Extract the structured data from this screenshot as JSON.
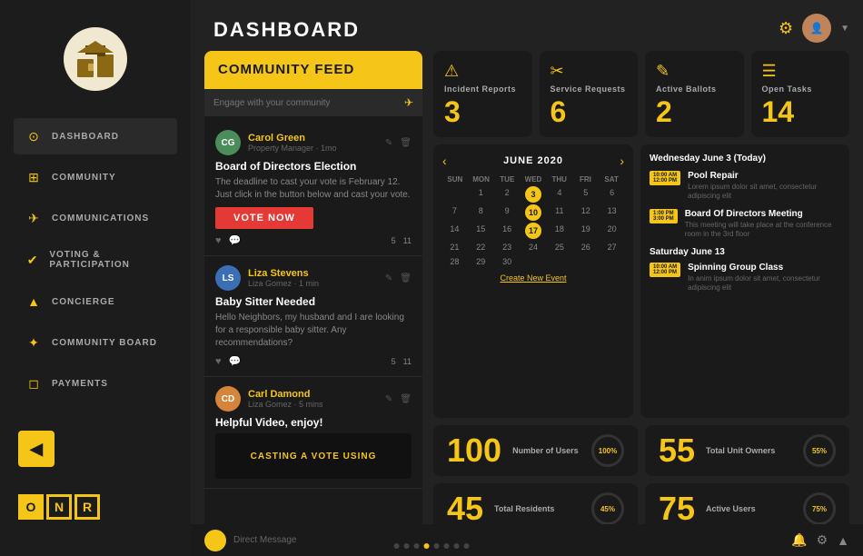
{
  "brand": {
    "logo_alt": "Property Manager Logo"
  },
  "sidebar": {
    "items": [
      {
        "id": "dashboard",
        "label": "DASHBOARD",
        "icon": "⊙"
      },
      {
        "id": "community",
        "label": "COMMUNITY",
        "icon": "⊞"
      },
      {
        "id": "communications",
        "label": "COMMUNICATIONS",
        "icon": "✈"
      },
      {
        "id": "voting",
        "label": "VOTING & PARTICIPATION",
        "icon": "✔"
      },
      {
        "id": "concierge",
        "label": "CONCIERGE",
        "icon": "▲"
      },
      {
        "id": "community-board",
        "label": "COMMUNITY BOARD",
        "icon": "✦"
      },
      {
        "id": "payments",
        "label": "PAYMENTS",
        "icon": "◻"
      }
    ],
    "brand_letters": [
      "O",
      "N",
      "R"
    ]
  },
  "dashboard": {
    "title": "DASHBOARD"
  },
  "feed": {
    "title": "COMMUNITY FEED",
    "search_placeholder": "Engage with your community",
    "posts": [
      {
        "author": "Carol Green",
        "role": "Property Manager · 1mo",
        "title": "Board of Directors Election",
        "text": "The deadline to cast your vote is February 12. Just click in the button below and cast your vote.",
        "type": "vote",
        "vote_label": "VOTE NOW",
        "likes": "5",
        "comments": "11"
      },
      {
        "author": "Liza Stevens",
        "role": "Liza Gomez · 1 min",
        "title": "Baby Sitter Needed",
        "text": "Hello Neighbors, my husband and I are looking for a responsible baby sitter. Any recommendations?",
        "type": "post",
        "likes": "5",
        "comments": "11"
      },
      {
        "author": "Carl Damond",
        "role": "Liza Gomez · 5 mins",
        "title": "Helpful Video, enjoy!",
        "text": "",
        "type": "video",
        "video_label": "CASTING A VOTE USING",
        "likes": "",
        "comments": ""
      }
    ]
  },
  "stats": [
    {
      "id": "incident-reports",
      "label": "Incident\nReports",
      "value": "3",
      "icon": "⚠"
    },
    {
      "id": "service-requests",
      "label": "Service\nRequests",
      "value": "6",
      "icon": "✂"
    },
    {
      "id": "active-ballots",
      "label": "Active\nBallots",
      "value": "2",
      "icon": "✎"
    },
    {
      "id": "open-tasks",
      "label": "Open\nTasks",
      "value": "14",
      "icon": "☰"
    }
  ],
  "calendar": {
    "month": "JUNE 2020",
    "day_names": [
      "SUN",
      "MON",
      "TUE",
      "WED",
      "THU",
      "FRI",
      "SAT"
    ],
    "weeks": [
      [
        null,
        1,
        2,
        3,
        4,
        5,
        6
      ],
      [
        7,
        8,
        9,
        10,
        11,
        12,
        13
      ],
      [
        14,
        15,
        16,
        17,
        18,
        19,
        20
      ],
      [
        21,
        22,
        23,
        24,
        25,
        26,
        27
      ],
      [
        28,
        29,
        30,
        null,
        null,
        null,
        null
      ]
    ],
    "active_days": [
      3,
      10,
      17
    ],
    "create_event": "Create New Event"
  },
  "events": {
    "date1": "Wednesday June 3 (Today)",
    "events_day1": [
      {
        "time": "10:00 AM\n12:00 PM",
        "title": "Pool Repair",
        "desc": "Lorem ipsum dolor sit amet, consectetur adipiscing elit"
      },
      {
        "time": "1:00 PM\n3:00 PM",
        "title": "Board Of Directors Meeting",
        "desc": "This meeting will take place at the conference room in the 3rd floor"
      }
    ],
    "date2": "Saturday June 13",
    "events_day2": [
      {
        "time": "10:00 AM\n12:00 PM",
        "title": "Spinning Group Class",
        "desc": "In anim ipsum dolor sit amet, consectetur adipiscing elit"
      }
    ]
  },
  "user_stats": [
    {
      "id": "num-users",
      "value": "100",
      "label": "Number of Users",
      "gauge": "100%"
    },
    {
      "id": "total-owners",
      "value": "55",
      "label": "Total Unit Owners",
      "gauge": "55%"
    },
    {
      "id": "total-residents",
      "value": "45",
      "label": "Total Residents",
      "gauge": "45%"
    },
    {
      "id": "active-users",
      "value": "75",
      "label": "Active Users",
      "gauge": "75%"
    }
  ],
  "bottom": {
    "message_placeholder": "Direct Message",
    "icons": [
      "🔔",
      "⚙"
    ]
  },
  "dots": [
    false,
    false,
    false,
    true,
    false,
    false,
    false,
    false
  ]
}
